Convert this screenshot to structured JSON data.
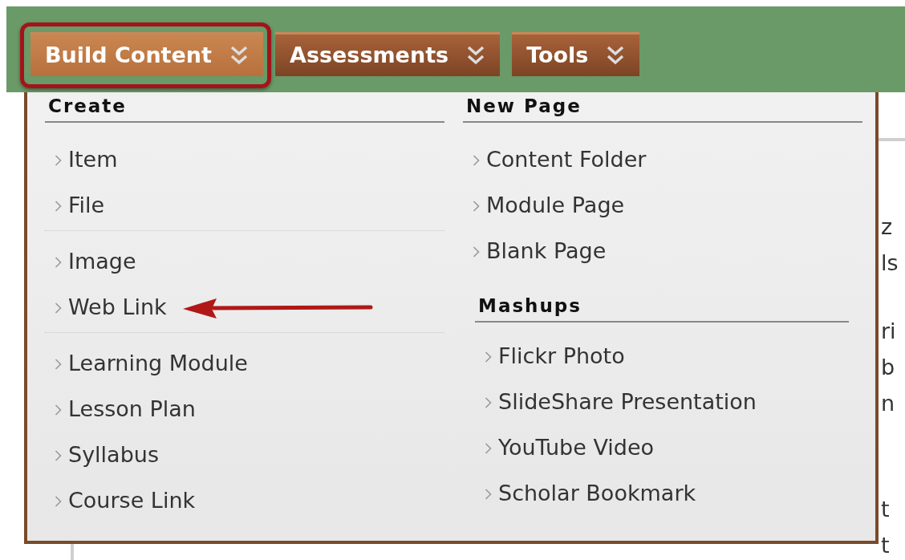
{
  "tabs": [
    {
      "label": "Build Content",
      "selected": true,
      "highlighted": true
    },
    {
      "label": "Assessments",
      "selected": false,
      "highlighted": false
    },
    {
      "label": "Tools",
      "selected": false,
      "highlighted": false
    }
  ],
  "menu": {
    "columns": [
      {
        "sections": [
          {
            "heading": "Create",
            "groups": [
              [
                {
                  "label": "Item",
                  "pointed": false
                },
                {
                  "label": "File",
                  "pointed": false
                }
              ],
              [
                {
                  "label": "Image",
                  "pointed": false
                },
                {
                  "label": "Web Link",
                  "pointed": true
                }
              ],
              [
                {
                  "label": "Learning Module",
                  "pointed": false
                },
                {
                  "label": "Lesson Plan",
                  "pointed": false
                },
                {
                  "label": "Syllabus",
                  "pointed": false
                },
                {
                  "label": "Course Link",
                  "pointed": false
                }
              ]
            ]
          }
        ]
      },
      {
        "sections": [
          {
            "heading": "New Page",
            "groups": [
              [
                {
                  "label": "Content Folder",
                  "pointed": false
                },
                {
                  "label": "Module Page",
                  "pointed": false
                },
                {
                  "label": "Blank Page",
                  "pointed": false
                }
              ]
            ]
          },
          {
            "heading": "Mashups",
            "groups": [
              [
                {
                  "label": "Flickr Photo",
                  "pointed": false
                },
                {
                  "label": "SlideShare Presentation",
                  "pointed": false
                },
                {
                  "label": "YouTube Video",
                  "pointed": false
                },
                {
                  "label": "Scholar Bookmark",
                  "pointed": false
                }
              ]
            ]
          }
        ]
      }
    ]
  },
  "page_text": {
    "paragraphs": [
      [
        "z",
        "ls"
      ],
      [
        "ri",
        "b",
        "n"
      ],
      [
        "t",
        "t"
      ]
    ]
  }
}
